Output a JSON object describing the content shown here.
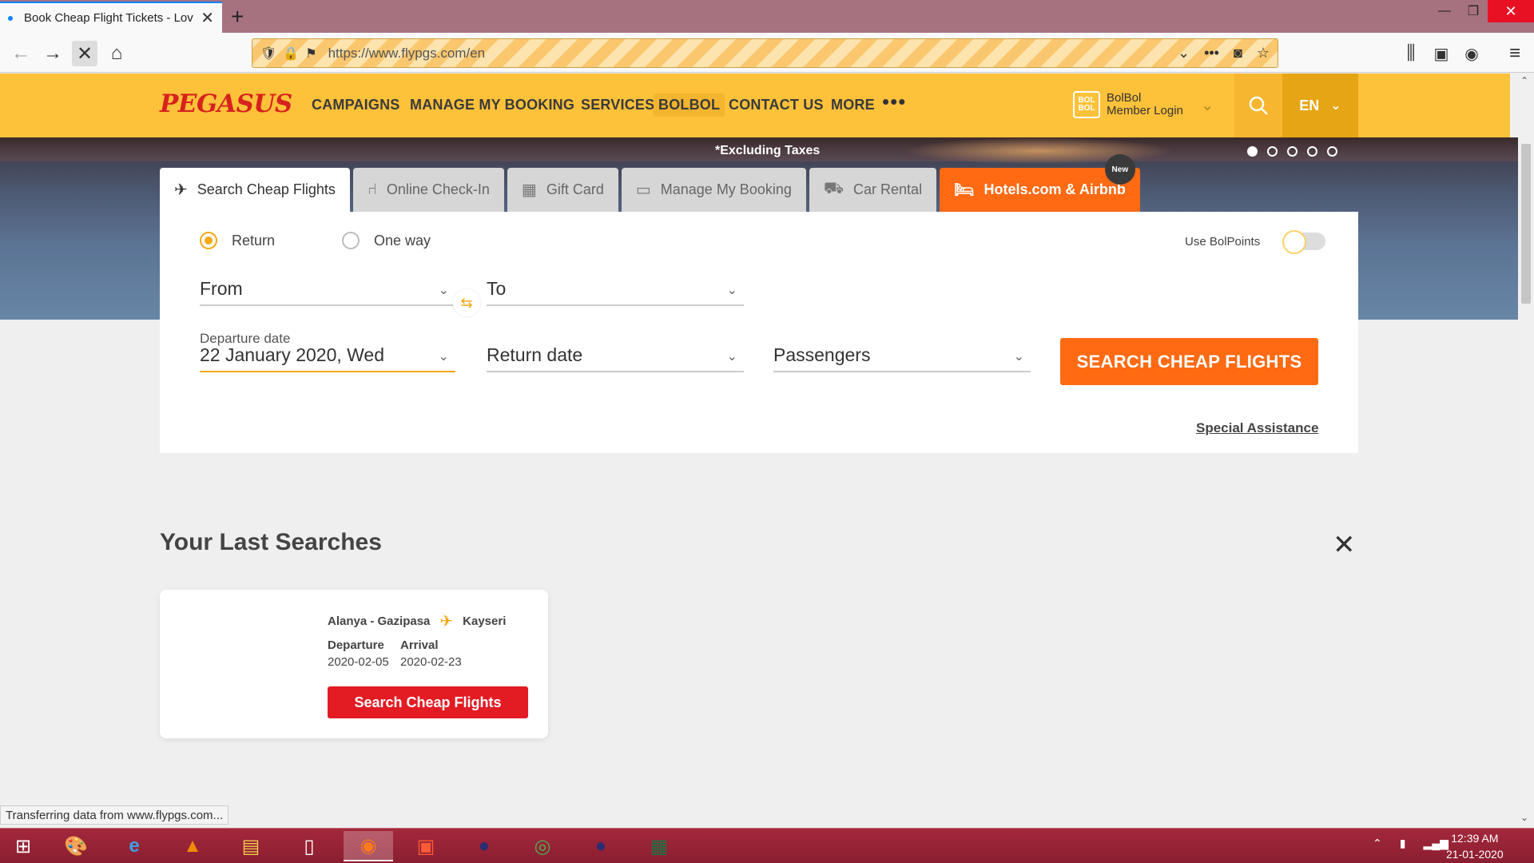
{
  "browser": {
    "tab_title": "Book Cheap Flight Tickets - Lov",
    "url": "https://www.flypgs.com/en",
    "status": "Transferring data from www.flypgs.com..."
  },
  "header": {
    "logo": "PEGASUS",
    "nav": [
      "CAMPAIGNS",
      "MANAGE MY BOOKING",
      "SERVICES",
      "BOLBOL",
      "CONTACT US",
      "MORE"
    ],
    "member_badge": "BOL BOL",
    "member_line1": "BolBol",
    "member_line2": "Member Login",
    "lang": "EN"
  },
  "hero": {
    "excluding": "*Excluding Taxes",
    "slides": 5,
    "active_slide": 1
  },
  "tabs": [
    {
      "label": "Search Cheap Flights",
      "icon": "plane-icon"
    },
    {
      "label": "Online Check-In",
      "icon": "seat-icon"
    },
    {
      "label": "Gift Card",
      "icon": "gift-icon"
    },
    {
      "label": "Manage My Booking",
      "icon": "ticket-icon"
    },
    {
      "label": "Car Rental",
      "icon": "car-icon"
    },
    {
      "label": "Hotels.com & Airbnb",
      "icon": "bed-icon",
      "badge": "New"
    }
  ],
  "form": {
    "return_label": "Return",
    "oneway_label": "One way",
    "trip_type_selected": "Return",
    "use_bolpoints": "Use BolPoints",
    "bolpoints_enabled": false,
    "from_label": "From",
    "to_label": "To",
    "departure_label": "Departure date",
    "departure_value": "22 January 2020, Wed",
    "return_date_label": "Return date",
    "passengers_label": "Passengers",
    "search_button": "SEARCH CHEAP FLIGHTS",
    "special_assistance": "Special Assistance"
  },
  "last_searches": {
    "title": "Your Last Searches",
    "items": [
      {
        "from": "Alanya - Gazipasa",
        "to": "Kayseri",
        "departure_label": "Departure",
        "departure": "2020-02-05",
        "arrival_label": "Arrival",
        "arrival": "2020-02-23",
        "button": "Search Cheap Flights"
      }
    ]
  },
  "taskbar": {
    "time": "12:39 AM",
    "date": "21-01-2020"
  },
  "colors": {
    "brand_yellow": "#fdc13a",
    "accent_orange": "#ff6a13",
    "logo_red": "#d7221d",
    "card_button_red": "#e31b23"
  }
}
